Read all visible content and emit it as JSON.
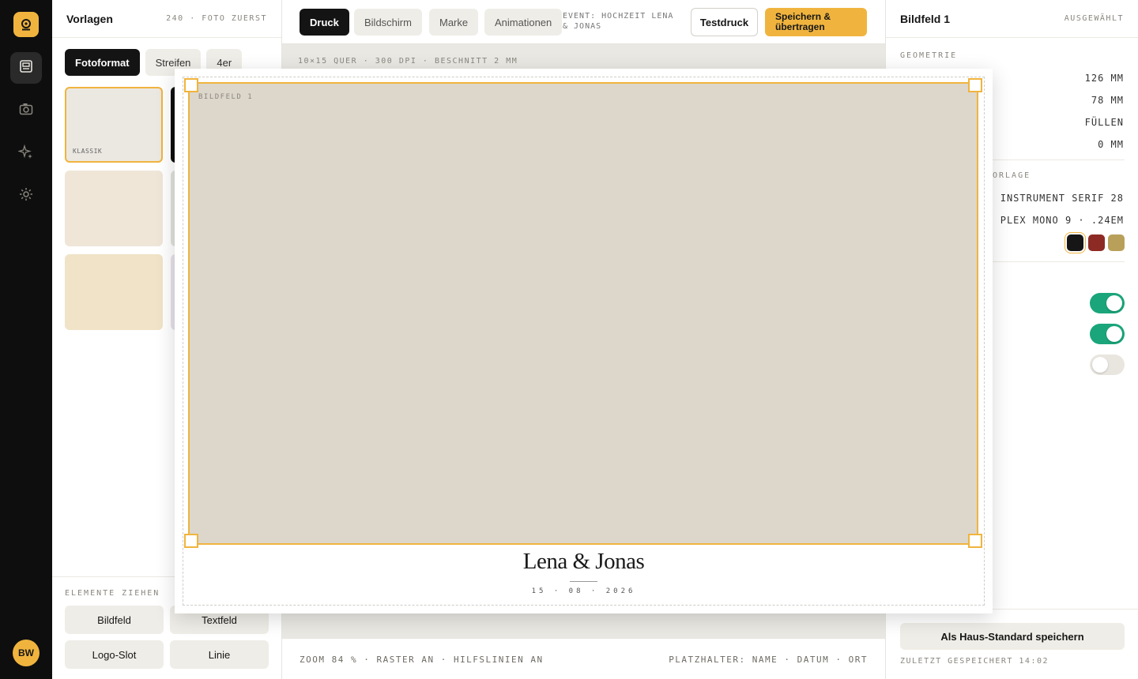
{
  "rail": {
    "logo_icon": "camera-logo-icon",
    "nav": [
      {
        "name": "templates-nav",
        "icon": "layout-icon",
        "active": true
      },
      {
        "name": "camera-nav",
        "icon": "camera-icon",
        "active": false
      },
      {
        "name": "effects-nav",
        "icon": "sparkle-icon",
        "active": false
      },
      {
        "name": "settings-nav",
        "icon": "gear-icon",
        "active": false
      }
    ],
    "avatar_initials": "BW"
  },
  "left": {
    "title": "Vorlagen",
    "meta": "240 · FOTO ZUERST",
    "chips": [
      "Fotoformat",
      "Streifen",
      "4er"
    ],
    "active_chip": "Fotoformat",
    "templates": [
      {
        "label": "KLASSIK",
        "color": "#ebe8e2",
        "selected": true
      },
      {
        "label": "",
        "color": "#0e0e0e",
        "selected": false
      },
      {
        "label": "",
        "color": "#efe6d8",
        "selected": false
      },
      {
        "label": "",
        "color": "#dfe2dc",
        "selected": false
      },
      {
        "label": "",
        "color": "#f0e3c7",
        "selected": false
      },
      {
        "label": "",
        "color": "#e6e2ea",
        "selected": false
      }
    ],
    "drag_caption": "ELEMENTE ZIEHEN",
    "elements": [
      "Bildfeld",
      "Textfeld",
      "Logo-Slot",
      "Linie"
    ]
  },
  "toolbar": {
    "tabs": [
      "Druck",
      "Bildschirm",
      "Marke",
      "Animationen"
    ],
    "active_tab": "Druck",
    "event": "EVENT: HOCHZEIT LENA & JONAS",
    "test_label": "Testdruck",
    "save_label": "Speichern & übertragen"
  },
  "canvas": {
    "info": "10×15 QUER · 300 DPI · BESCHNITT 2 MM",
    "photo_label": "BILDFELD 1",
    "names": "Lena & Jonas",
    "date": "15 · 08 · 2026"
  },
  "statusbar": {
    "left": "ZOOM 84 % · RASTER AN · HILFSLINIEN AN",
    "right": "PLATZHALTER: NAME · DATUM · ORT"
  },
  "inspector": {
    "title": "Bildfeld 1",
    "meta": "AUSGEWÄHLT",
    "geometry_heading": "GEOMETRIE",
    "geometry_values": [
      "126 MM",
      "78 MM",
      "FÜLLEN",
      "0 MM"
    ],
    "typo_heading": "ORLAGE",
    "typo_values": [
      "INSTRUMENT SERIF 28",
      "PLEX MONO 9 · .24EM"
    ],
    "swatches": [
      "#161616",
      "#8e2a24",
      "#b9a05a"
    ],
    "toggles": [
      true,
      true,
      false
    ],
    "house_button": "Als Haus-Standard speichern",
    "last_saved": "ZULETZT GESPEICHERT 14:02"
  }
}
